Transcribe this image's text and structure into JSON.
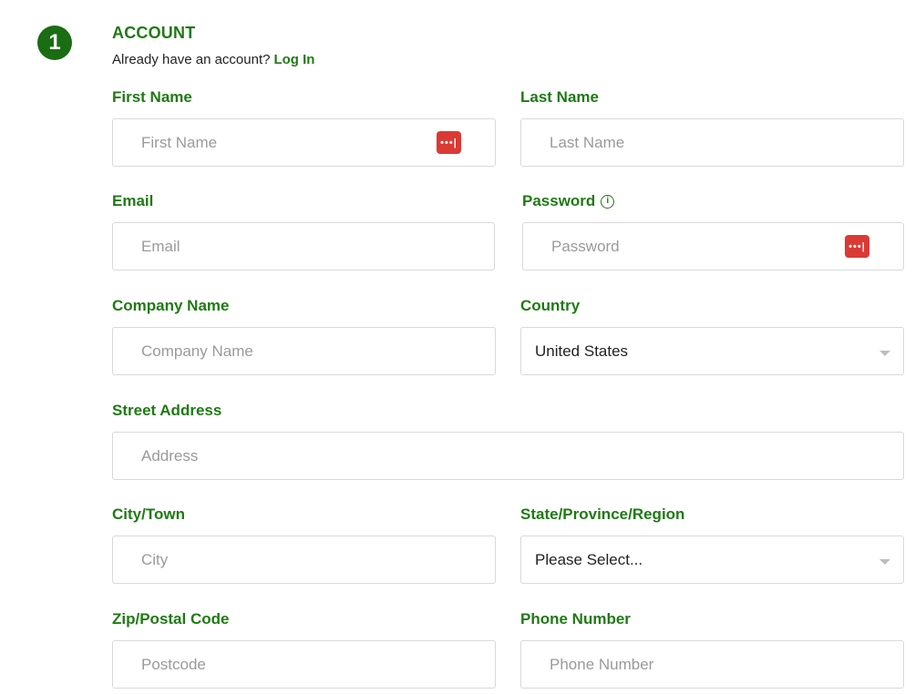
{
  "section": {
    "step_number": "1",
    "title": "ACCOUNT",
    "login_prompt": "Already have an account?",
    "login_link": "Log In"
  },
  "fields": {
    "first_name": {
      "label": "First Name",
      "placeholder": "First Name",
      "value": ""
    },
    "last_name": {
      "label": "Last Name",
      "placeholder": "Last Name",
      "value": ""
    },
    "email": {
      "label": "Email",
      "placeholder": "Email",
      "value": ""
    },
    "password": {
      "label": "Password",
      "placeholder": "Password",
      "value": ""
    },
    "company_name": {
      "label": "Company Name",
      "placeholder": "Company Name",
      "value": ""
    },
    "country": {
      "label": "Country",
      "selected": "United States"
    },
    "street_address": {
      "label": "Street Address",
      "placeholder": "Address",
      "value": ""
    },
    "city": {
      "label": "City/Town",
      "placeholder": "City",
      "value": ""
    },
    "state": {
      "label": "State/Province/Region",
      "selected": "Please Select..."
    },
    "zip": {
      "label": "Zip/Postal Code",
      "placeholder": "Postcode",
      "value": ""
    },
    "phone": {
      "label": "Phone Number",
      "placeholder": "Phone Number",
      "value": ""
    }
  },
  "icons": {
    "password_manager": "password-manager-icon",
    "info": "info-icon",
    "dropdown": "chevron-down-icon"
  },
  "colors": {
    "accent": "#1f7a14",
    "badge": "#1a6d12",
    "password_manager": "#db3a34",
    "border": "#d9d9d9",
    "placeholder": "#9a9a9a"
  }
}
